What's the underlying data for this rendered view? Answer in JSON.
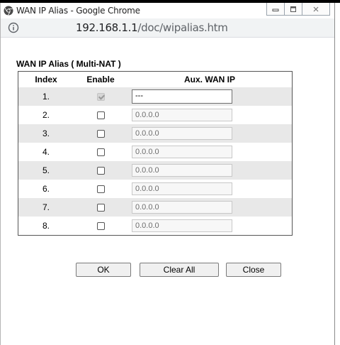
{
  "window": {
    "title": "WAN IP Alias - Google Chrome",
    "url_host": "192.168.1.1",
    "url_path": "/doc/wipalias.htm"
  },
  "section_title": "WAN  IP Alias ( Multi-NAT )",
  "table": {
    "headers": [
      "Index",
      "Enable",
      "Aux. WAN IP"
    ],
    "rows": [
      {
        "index": "1.",
        "enabled": true,
        "ip": "---"
      },
      {
        "index": "2.",
        "enabled": false,
        "ip": "0.0.0.0"
      },
      {
        "index": "3.",
        "enabled": false,
        "ip": "0.0.0.0"
      },
      {
        "index": "4.",
        "enabled": false,
        "ip": "0.0.0.0"
      },
      {
        "index": "5.",
        "enabled": false,
        "ip": "0.0.0.0"
      },
      {
        "index": "6.",
        "enabled": false,
        "ip": "0.0.0.0"
      },
      {
        "index": "7.",
        "enabled": false,
        "ip": "0.0.0.0"
      },
      {
        "index": "8.",
        "enabled": false,
        "ip": "0.0.0.0"
      }
    ]
  },
  "buttons": {
    "ok": "OK",
    "clear_all": "Clear All",
    "close": "Close"
  }
}
